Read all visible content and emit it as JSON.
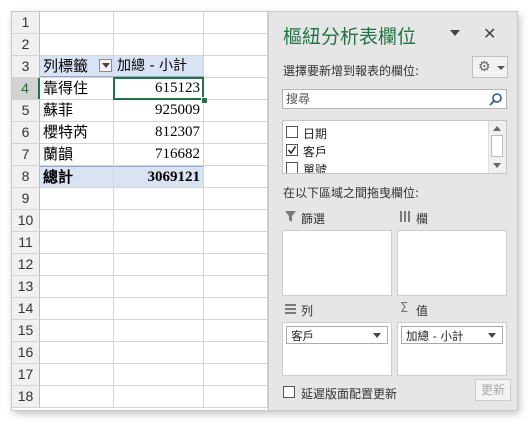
{
  "sheet": {
    "row_numbers": [
      "1",
      "2",
      "3",
      "4",
      "5",
      "6",
      "7",
      "8",
      "9",
      "10",
      "11",
      "12",
      "13",
      "14",
      "15",
      "16",
      "17",
      "18"
    ],
    "pivot_header": {
      "row_label": "列標籤",
      "value_label": "加總 - 小計"
    },
    "pivot_rows": [
      {
        "label": "靠得住",
        "value": "615123"
      },
      {
        "label": "蘇菲",
        "value": "925009"
      },
      {
        "label": "櫻特芮",
        "value": "812307"
      },
      {
        "label": "蘭韻",
        "value": "716682"
      }
    ],
    "grand_total": {
      "label": "總計",
      "value": "3069121"
    },
    "selected_row": "4"
  },
  "pane": {
    "title": "樞紐分析表欄位",
    "close_glyph": "✕",
    "choose_fields_label": "選擇要新增到報表的欄位:",
    "gear_glyph": "⚙",
    "search_placeholder": "搜尋",
    "fields": [
      {
        "label": "日期",
        "checked": false
      },
      {
        "label": "客戶",
        "checked": true
      },
      {
        "label": "單號",
        "checked": false
      }
    ],
    "drag_label": "在以下區域之間拖曳欄位:",
    "areas": {
      "filters": {
        "label": "篩選",
        "icon": "filter-icon"
      },
      "columns": {
        "label": "欄",
        "icon": "columns-icon"
      },
      "rows": {
        "label": "列",
        "icon": "rows-icon",
        "chip": "客戶"
      },
      "values": {
        "label": "值",
        "icon": "sigma-icon",
        "chip": "加總 - 小計"
      }
    },
    "defer_label": "延遲版面配置更新",
    "update_label": "更新"
  },
  "colors": {
    "accent": "#217346",
    "pivot_fill": "#dae3f3",
    "pane_bg": "#e6e6e6"
  }
}
